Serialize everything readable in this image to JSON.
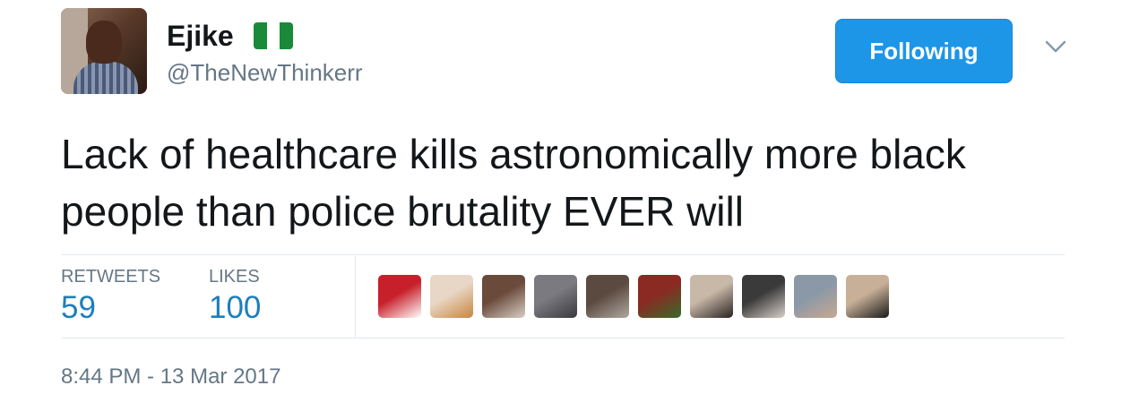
{
  "author": {
    "name": "Ejike",
    "handle": "@TheNewThinkerr",
    "flag_icon": "nigeria-flag-icon",
    "flag_colors": [
      "#1a8a3a",
      "#ffffff",
      "#1a8a3a"
    ]
  },
  "actions": {
    "follow_label": "Following",
    "follow_color": "#1d96e8",
    "menu_icon": "chevron-down-icon"
  },
  "tweet": {
    "text": "Lack of healthcare kills astronomically more black people than police brutality EVER will"
  },
  "stats": {
    "retweets_label": "RETWEETS",
    "retweets_value": "59",
    "likes_label": "LIKES",
    "likes_value": "100"
  },
  "likers": [
    {
      "colors": [
        "#c8202a",
        "#ffffff"
      ]
    },
    {
      "colors": [
        "#e8d7c6",
        "#c9853e"
      ]
    },
    {
      "colors": [
        "#6a4a3a",
        "#d8cfc5"
      ]
    },
    {
      "colors": [
        "#7a7a80",
        "#3a3a3e"
      ]
    },
    {
      "colors": [
        "#5a4a40",
        "#b0a8a0"
      ]
    },
    {
      "colors": [
        "#8a2a22",
        "#3a6a2a"
      ]
    },
    {
      "colors": [
        "#c8b8a8",
        "#2a2220"
      ]
    },
    {
      "colors": [
        "#3a3a3a",
        "#d8d0c8"
      ]
    },
    {
      "colors": [
        "#8a98a8",
        "#c8a890"
      ]
    },
    {
      "colors": [
        "#c8b098",
        "#1a1a1a"
      ]
    }
  ],
  "timestamp": "8:44 PM - 13 Mar 2017"
}
